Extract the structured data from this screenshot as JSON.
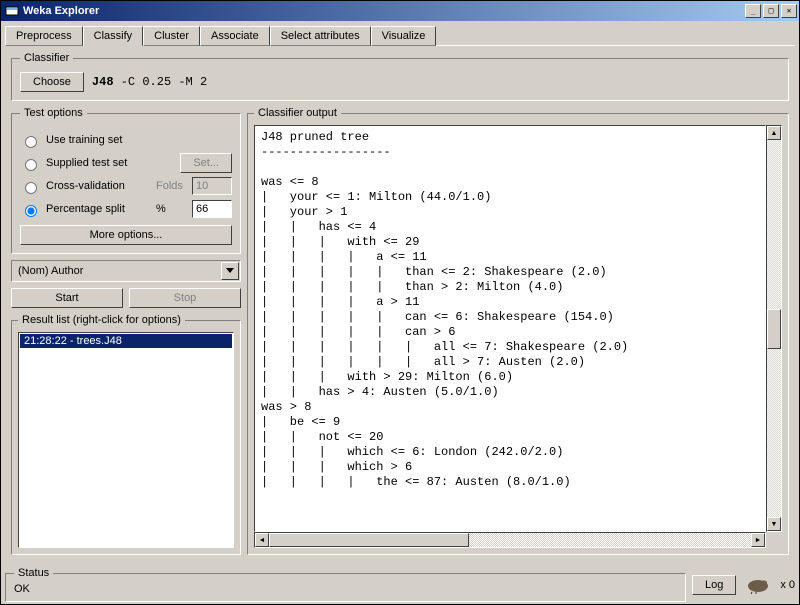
{
  "window": {
    "title": "Weka Explorer"
  },
  "tabs": {
    "items": [
      "Preprocess",
      "Classify",
      "Cluster",
      "Associate",
      "Select attributes",
      "Visualize"
    ],
    "active": "Classify"
  },
  "classifier_panel": {
    "legend": "Classifier",
    "choose_label": "Choose",
    "scheme_name": "J48",
    "scheme_args": " -C 0.25 -M 2"
  },
  "test_options": {
    "legend": "Test options",
    "radios": [
      {
        "label": "Use training set",
        "param": "",
        "value": "",
        "checked": false,
        "enabled": true
      },
      {
        "label": "Supplied test set",
        "param": "",
        "value": "",
        "checked": false,
        "enabled": true,
        "button": "Set..."
      },
      {
        "label": "Cross-validation",
        "param": "Folds",
        "value": "10",
        "checked": false,
        "enabled": false
      },
      {
        "label": "Percentage split",
        "param": "%",
        "value": "66",
        "checked": true,
        "enabled": true
      }
    ],
    "more_label": "More options..."
  },
  "class_combo": {
    "value": "(Nom) Author"
  },
  "run": {
    "start": "Start",
    "stop": "Stop"
  },
  "result_list": {
    "legend": "Result list (right-click for options)",
    "items": [
      "21:28:22 - trees.J48"
    ]
  },
  "output_panel": {
    "legend": "Classifier output",
    "text": "J48 pruned tree\n------------------\n\nwas <= 8\n|   your <= 1: Milton (44.0/1.0)\n|   your > 1\n|   |   has <= 4\n|   |   |   with <= 29\n|   |   |   |   a <= 11\n|   |   |   |   |   than <= 2: Shakespeare (2.0)\n|   |   |   |   |   than > 2: Milton (4.0)\n|   |   |   |   a > 11\n|   |   |   |   |   can <= 6: Shakespeare (154.0)\n|   |   |   |   |   can > 6\n|   |   |   |   |   |   all <= 7: Shakespeare (2.0)\n|   |   |   |   |   |   all > 7: Austen (2.0)\n|   |   |   with > 29: Milton (6.0)\n|   |   has > 4: Austen (5.0/1.0)\nwas > 8\n|   be <= 9\n|   |   not <= 20\n|   |   |   which <= 6: London (242.0/2.0)\n|   |   |   which > 6\n|   |   |   |   the <= 87: Austen (8.0/1.0)"
  },
  "status": {
    "legend": "Status",
    "text": "OK",
    "log": "Log",
    "count": "x 0"
  }
}
